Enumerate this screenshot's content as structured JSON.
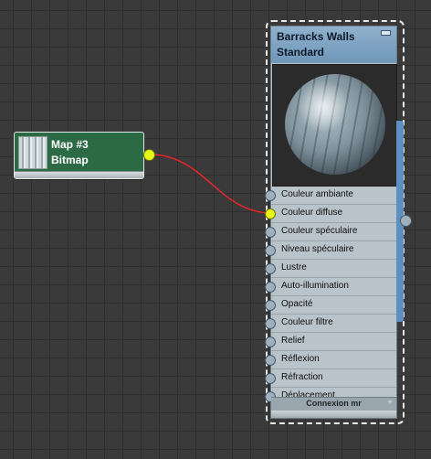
{
  "map_node": {
    "title": "Map #3",
    "subtitle": "Bitmap",
    "color": "#2c6a46"
  },
  "material_node": {
    "title": "Barracks Walls",
    "subtitle": "Standard",
    "header_color": "#7fa4c4",
    "slots": [
      {
        "label": "Couleur ambiante",
        "connected": false
      },
      {
        "label": "Couleur diffuse",
        "connected": true
      },
      {
        "label": "Couleur spéculaire",
        "connected": false
      },
      {
        "label": "Niveau spéculaire",
        "connected": false
      },
      {
        "label": "Lustre",
        "connected": false
      },
      {
        "label": "Auto-illumination",
        "connected": false
      },
      {
        "label": "Opacité",
        "connected": false
      },
      {
        "label": "Couleur filtre",
        "connected": false
      },
      {
        "label": "Relief",
        "connected": false
      },
      {
        "label": "Réflexion",
        "connected": false
      },
      {
        "label": "Réfraction",
        "connected": false
      },
      {
        "label": "Déplacement",
        "connected": false
      }
    ],
    "footer_label": "Connexion mr"
  },
  "wire_color": "#e5262a",
  "socket_active_color": "#e8f516"
}
